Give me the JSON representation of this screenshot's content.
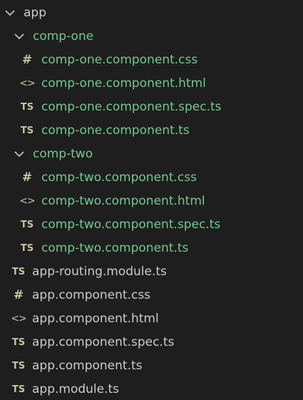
{
  "explorer": {
    "root": {
      "label": "app",
      "expanded": true,
      "folders": [
        {
          "label": "comp-one",
          "expanded": true,
          "files": [
            {
              "icon": "css-hash-icon",
              "glyph": "#",
              "name": "comp-one.component.css"
            },
            {
              "icon": "html-brackets-icon",
              "glyph": "<>",
              "name": "comp-one.component.html"
            },
            {
              "icon": "typescript-icon",
              "glyph": "TS",
              "name": "comp-one.component.spec.ts"
            },
            {
              "icon": "typescript-icon",
              "glyph": "TS",
              "name": "comp-one.component.ts"
            }
          ]
        },
        {
          "label": "comp-two",
          "expanded": true,
          "files": [
            {
              "icon": "css-hash-icon",
              "glyph": "#",
              "name": "comp-two.component.css"
            },
            {
              "icon": "html-brackets-icon",
              "glyph": "<>",
              "name": "comp-two.component.html"
            },
            {
              "icon": "typescript-icon",
              "glyph": "TS",
              "name": "comp-two.component.spec.ts"
            },
            {
              "icon": "typescript-icon",
              "glyph": "TS",
              "name": "comp-two.component.ts"
            }
          ]
        }
      ],
      "files": [
        {
          "icon": "typescript-icon",
          "glyph": "TS",
          "name": "app-routing.module.ts"
        },
        {
          "icon": "css-hash-icon",
          "glyph": "#",
          "name": "app.component.css"
        },
        {
          "icon": "html-brackets-icon",
          "glyph": "<>",
          "name": "app.component.html"
        },
        {
          "icon": "typescript-icon",
          "glyph": "TS",
          "name": "app.component.spec.ts"
        },
        {
          "icon": "typescript-icon",
          "glyph": "TS",
          "name": "app.component.ts"
        },
        {
          "icon": "typescript-icon",
          "glyph": "TS",
          "name": "app.module.ts"
        }
      ]
    },
    "colors": {
      "background": "#1e1e1e",
      "untracked_green": "#73c991",
      "default_text": "#cccccc",
      "icon_tint": "#c8c3a4"
    }
  }
}
